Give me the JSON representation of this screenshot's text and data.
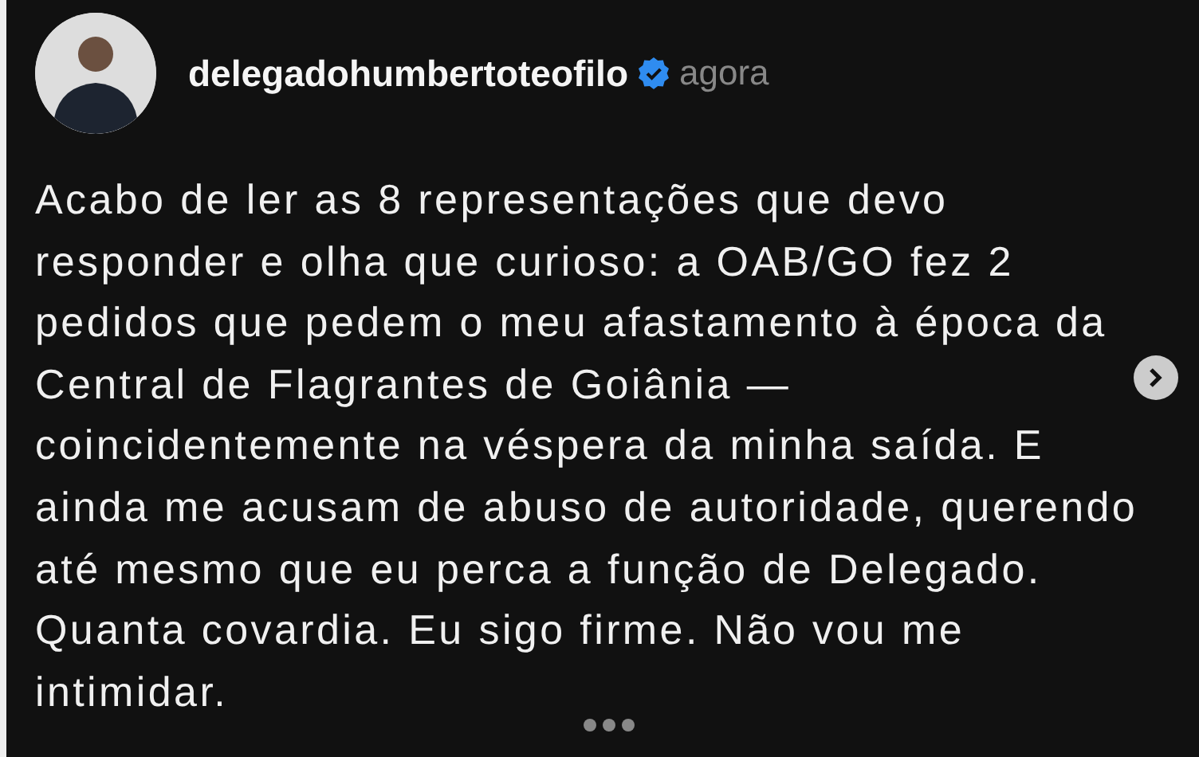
{
  "post": {
    "username": "delegadohumbertoteofilo",
    "verified": true,
    "time": "agora",
    "text": "Acabo de ler as 8 representações que devo responder e olha que curioso: a OAB/GO fez 2 pedidos que pedem o meu afastamento à época da Central de Flagrantes de Goiânia — coincidentemente na véspera da minha saída. E ainda me acusam de abuso de autoridade, querendo até mesmo que eu perca a função de Delegado. Quanta covardia. Eu sigo firme. Não vou me intimidar."
  }
}
